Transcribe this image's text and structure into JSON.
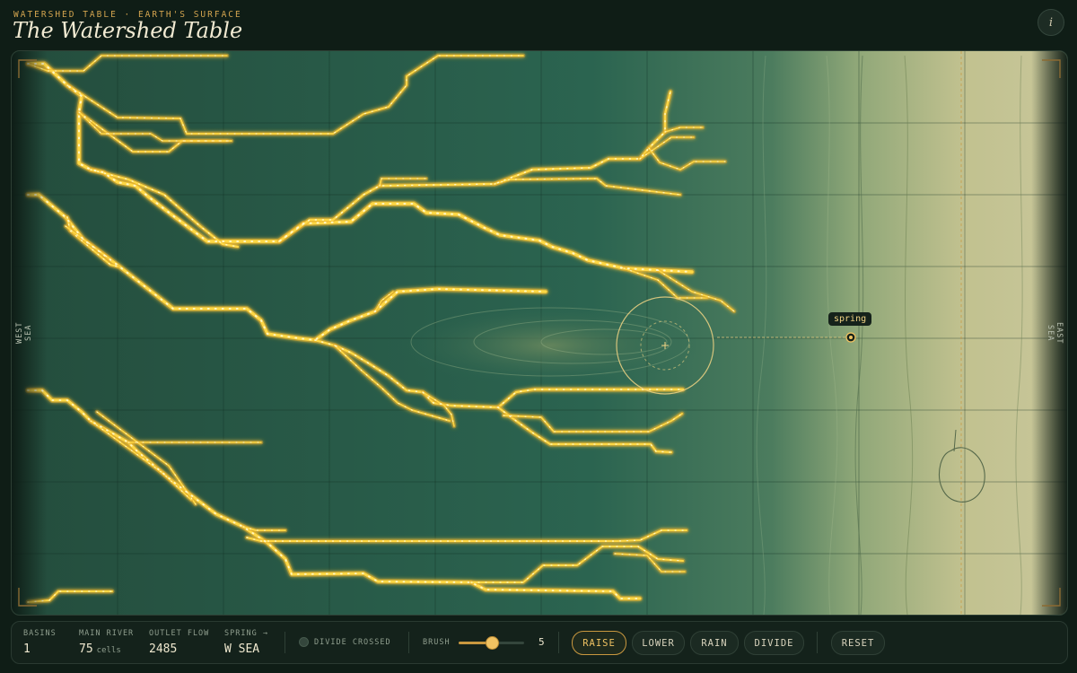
{
  "header": {
    "eyebrow": "WATERSHED TABLE · EARTH'S SURFACE",
    "title": "The Watershed Table",
    "info_label": "i"
  },
  "map": {
    "west_label": "WEST SEA",
    "east_label": "EAST SEA",
    "spring_label": "spring",
    "colors": {
      "lowland": "#2a5a48",
      "highland": "#c3c28e",
      "river": "#ffd845",
      "river_glow": "#e0a627"
    }
  },
  "stats": {
    "basins": {
      "label": "BASINS",
      "value": "1"
    },
    "main_river": {
      "label": "MAIN RIVER",
      "value": "75",
      "unit": "cells"
    },
    "outlet_flow": {
      "label": "OUTLET FLOW",
      "value": "2485"
    },
    "spring": {
      "label": "SPRING →",
      "value": "W SEA"
    }
  },
  "divide": {
    "label": "DIVIDE CROSSED",
    "crossed": false
  },
  "brush": {
    "label": "BRUSH",
    "value": "5",
    "level": 0.5
  },
  "tools": {
    "raise": "RAISE",
    "lower": "LOWER",
    "rain": "RAIN",
    "divide": "DIVIDE",
    "reset": "RESET",
    "active": "raise"
  }
}
